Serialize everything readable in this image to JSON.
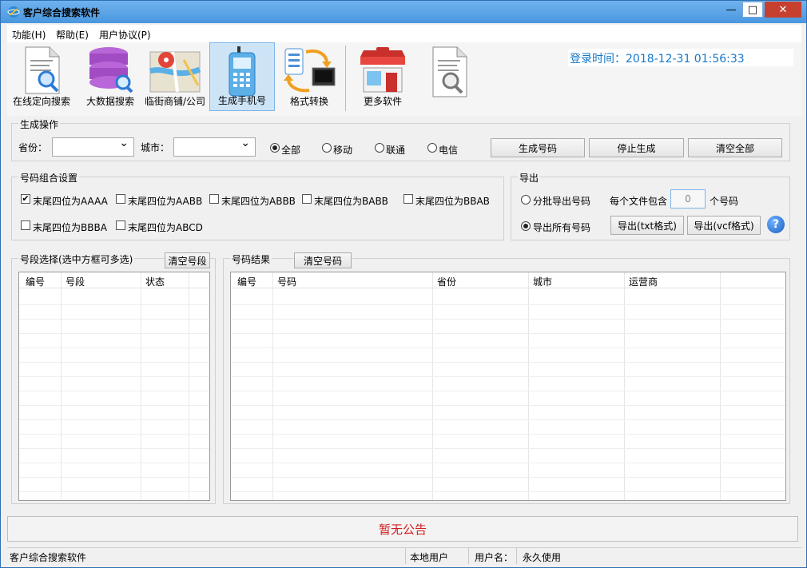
{
  "window": {
    "title": "客户综合搜索软件",
    "minimize_symbol": "—",
    "maximize_symbol": "□",
    "close_symbol": "✕"
  },
  "menu": [
    "功能(H)",
    "帮助(E)",
    "用户协议(P)"
  ],
  "toolbar": {
    "items": [
      "在线定向搜索",
      "大数据搜索",
      "临街商铺/公司",
      "生成手机号",
      "格式转换",
      "更多软件"
    ],
    "login_time": "登录时间：2018-12-31 01:56:33"
  },
  "generate": {
    "group_label": "生成操作",
    "province_label": "省份：",
    "city_label": "城市：",
    "province_value": "",
    "city_value": "",
    "carriers": [
      "全部",
      "移动",
      "联通",
      "电信"
    ],
    "buttons": [
      "生成号码",
      "停止生成",
      "清空全部"
    ]
  },
  "combo": {
    "group_label": "号码组合设置",
    "options": [
      "末尾四位为AAAA",
      "末尾四位为AABB",
      "末尾四位为ABBB",
      "末尾四位为BABB",
      "末尾四位为BBAB",
      "末尾四位为BBBA",
      "末尾四位为ABCD"
    ]
  },
  "export": {
    "group_label": "导出",
    "batch_label": "分批导出号码",
    "per_file_label": "每个文件包含",
    "per_file_value": "0",
    "per_file_unit": "个号码",
    "all_label": "导出所有号码",
    "buttons": [
      "导出(txt格式)",
      "导出(vcf格式)"
    ],
    "help_symbol": "?"
  },
  "segments": {
    "group_label": "号段选择(选中方框可多选)",
    "clear_label": "清空号段",
    "columns": [
      "编号",
      "号段",
      "状态"
    ]
  },
  "results": {
    "group_label": "号码结果",
    "clear_label": "清空号码",
    "columns": [
      "编号",
      "号码",
      "省份",
      "城市",
      "运营商"
    ]
  },
  "notice": "暂无公告",
  "status": {
    "app_name": "客户综合搜索软件",
    "user_type": "本地用户",
    "user_label": "用户名：",
    "license": "永久使用"
  }
}
